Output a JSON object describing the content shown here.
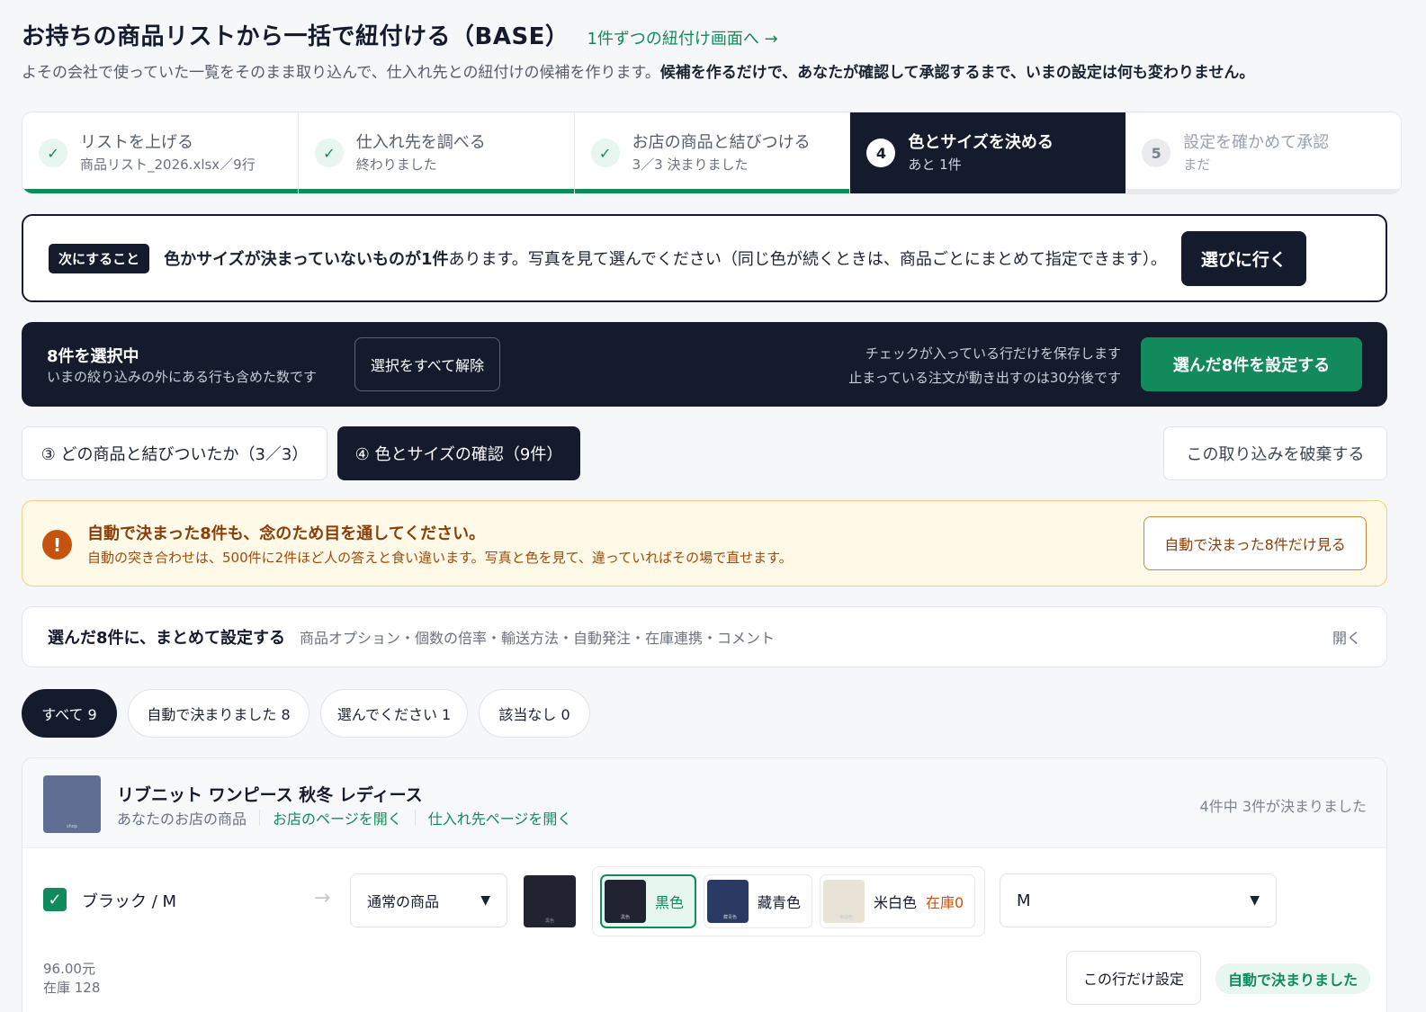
{
  "header": {
    "title": "お持ちの商品リストから一括で紐付ける（BASE）",
    "single_link": "1件ずつの紐付け画面へ →",
    "subtitle": "よその会社で使っていた一覧をそのまま取り込んで、仕入れ先との紐付けの候補を作ります。",
    "subtitle_bold": "候補を作るだけで、あなたが確認して承認するまで、いまの設定は何も変わりません。"
  },
  "steps": [
    {
      "badge": "✓",
      "label": "リストを上げる",
      "sub": "商品リスト_2026.xlsx／9行",
      "state": "done"
    },
    {
      "badge": "✓",
      "label": "仕入れ先を調べる",
      "sub": "終わりました",
      "state": "done"
    },
    {
      "badge": "✓",
      "label": "お店の商品と結びつける",
      "sub": "3／3 決まりました",
      "state": "done"
    },
    {
      "badge": "4",
      "label": "色とサイズを決める",
      "sub": "あと 1件",
      "state": "active"
    },
    {
      "badge": "5",
      "label": "設定を確かめて承認",
      "sub": "まだ",
      "state": "todo"
    }
  ],
  "next_action": {
    "tag": "次にすること",
    "bold": "色かサイズが決まっていないものが1件",
    "text": "あります。写真を見て選んでください（同じ色が続くときは、商品ごとにまとめて指定できます）。",
    "button": "選びに行く"
  },
  "selection": {
    "count": "8件を選択中",
    "note": "いまの絞り込みの外にある行も含めた数です",
    "clear": "選択をすべて解除",
    "hint1": "チェックが入っている行だけを保存します",
    "hint2": "止まっている注文が動き出すのは30分後です",
    "apply": "選んだ8件を設定する"
  },
  "tabs": {
    "tab3": "③ どの商品と結びついたか（3／3）",
    "tab4": "④ 色とサイズの確認（9件）",
    "discard": "この取り込みを破棄する"
  },
  "warning": {
    "icon": "!",
    "title": "自動で決まった8件も、念のため目を通してください。",
    "text": "自動の突き合わせは、500件に2件ほど人の答えと食い違います。写真と色を見て、違っていればその場で直せます。",
    "button": "自動で決まった8件だけ見る"
  },
  "bulk": {
    "title": "選んだ8件に、まとめて設定する",
    "sub": "商品オプション・個数の倍率・輸送方法・自動発注・在庫連携・コメント",
    "open": "開く"
  },
  "filters": [
    {
      "label": "すべて 9",
      "active": true
    },
    {
      "label": "自動で決まりました 8",
      "active": false
    },
    {
      "label": "選んでください 1",
      "active": false
    },
    {
      "label": "該当なし 0",
      "active": false
    }
  ],
  "product": {
    "thumb_text": "shop",
    "name": "リブニット ワンピース 秋冬 レディース",
    "shop_label": "あなたのお店の商品",
    "shop_link": "お店のページを開く",
    "supplier_link": "仕入れ先ページを開く",
    "status": "4件中 3件が決まりました",
    "row": {
      "checked": "✓",
      "variant": "ブラック / M",
      "arrow": "→",
      "kind": "通常の商品",
      "swatch_text": "黒色",
      "colors": [
        {
          "name": "黒色",
          "swatch": "#212430",
          "tiny": "黒色"
        },
        {
          "name": "藏青色",
          "swatch": "#2b3a63",
          "tiny": "藏青色"
        },
        {
          "name": "米白色",
          "swatch": "#e9e3d6",
          "tiny": "米白色",
          "stock": "在庫0"
        }
      ],
      "size": "M",
      "price": "96.00元",
      "stock": "在庫 128",
      "row_button": "この行だけ設定",
      "auto": "自動で決まりました"
    }
  },
  "colors": {
    "brand_green": "#138a5c",
    "navy": "#141b2d",
    "warn_orange": "#c5530c"
  }
}
